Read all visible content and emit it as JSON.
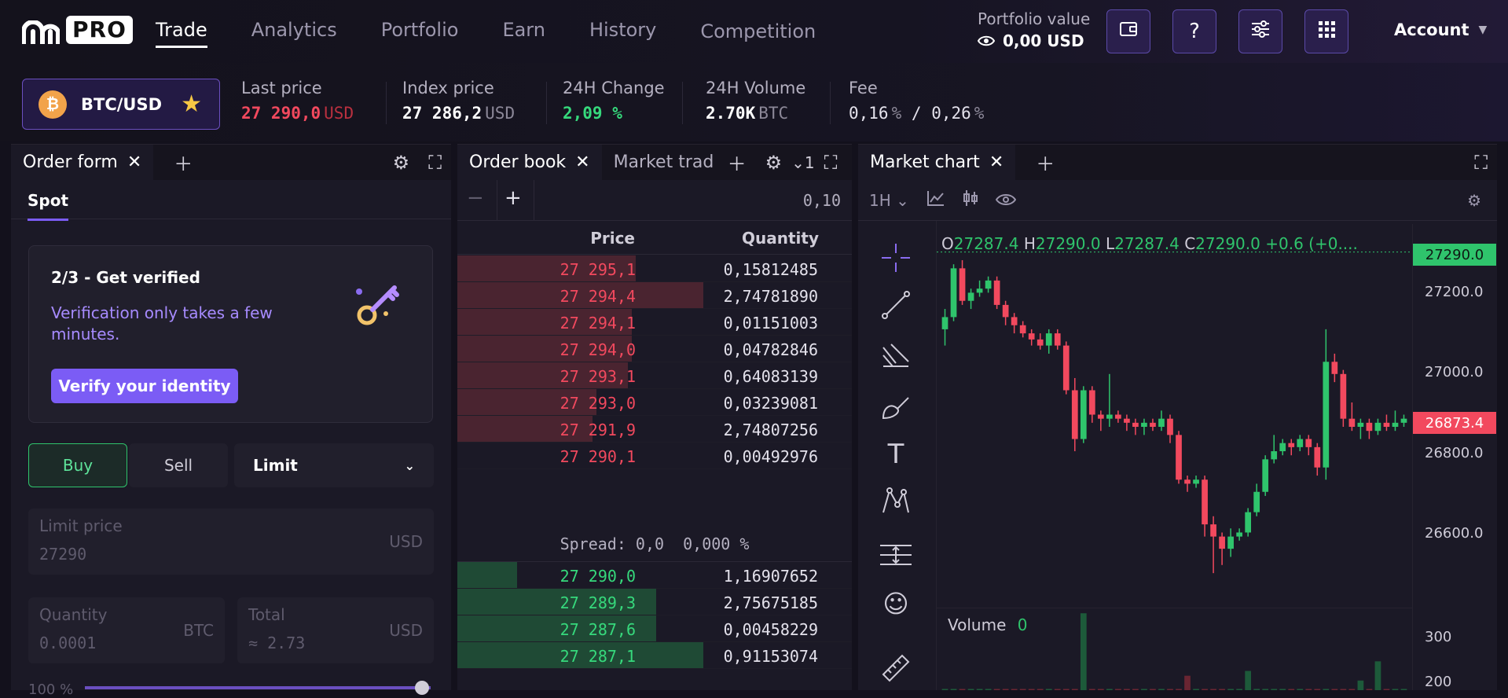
{
  "header": {
    "logo_text": "PRO",
    "nav": [
      "Trade",
      "Analytics",
      "Portfolio",
      "Earn",
      "History",
      "Competition"
    ],
    "portfolio_label": "Portfolio value",
    "portfolio_value": "0,00 USD",
    "account_label": "Account"
  },
  "ticker": {
    "pair": "BTC/USD",
    "last_price_label": "Last price",
    "last_price": "27 290,0",
    "last_price_unit": "USD",
    "index_price_label": "Index price",
    "index_price": "27 286,2",
    "index_price_unit": "USD",
    "change_label": "24H Change",
    "change": "2,09 %",
    "volume_label": "24H Volume",
    "volume": "2.70K",
    "volume_unit": "BTC",
    "fee_label": "Fee",
    "fee_maker": "0,16",
    "fee_taker": "0,26",
    "fee_pct": "%",
    "fee_sep": "/"
  },
  "order_form": {
    "tab_label": "Order form",
    "sub_tab": "Spot",
    "verify_title": "2/3 - Get verified",
    "verify_text": "Verification only takes a few minutes.",
    "verify_button": "Verify your identity",
    "buy_label": "Buy",
    "sell_label": "Sell",
    "order_type": "Limit",
    "limit_price_label": "Limit price",
    "limit_price_value": "27290",
    "limit_price_unit": "USD",
    "quantity_label": "Quantity",
    "quantity_value": "0.0001",
    "quantity_unit": "BTC",
    "total_label": "Total",
    "total_value": "≈ 2.73",
    "total_unit": "USD",
    "slider_label": "100 %"
  },
  "order_book": {
    "tab_label": "Order book",
    "tab2_label": "Market trad",
    "depth_count": "1",
    "tick_size": "0,10",
    "price_header": "Price",
    "qty_header": "Quantity",
    "spread": "Spread: 0,0  0,000 %",
    "asks": [
      {
        "price": "27 295,1",
        "qty": "0,15812485",
        "depth": 0.45
      },
      {
        "price": "27 294,4",
        "qty": "2,74781890",
        "depth": 0.62
      },
      {
        "price": "27 294,1",
        "qty": "0,01151003",
        "depth": 0.44
      },
      {
        "price": "27 294,0",
        "qty": "0,04782846",
        "depth": 0.44
      },
      {
        "price": "27 293,1",
        "qty": "0,64083139",
        "depth": 0.43
      },
      {
        "price": "27 293,0",
        "qty": "0,03239081",
        "depth": 0.35
      },
      {
        "price": "27 291,9",
        "qty": "2,74807256",
        "depth": 0.34
      },
      {
        "price": "27 290,1",
        "qty": "0,00492976",
        "depth": 0.0
      }
    ],
    "bids": [
      {
        "price": "27 290,0",
        "qty": "1,16907652",
        "depth": 0.15
      },
      {
        "price": "27 289,3",
        "qty": "2,75675185",
        "depth": 0.5
      },
      {
        "price": "27 287,6",
        "qty": "0,00458229",
        "depth": 0.5
      },
      {
        "price": "27 287,1",
        "qty": "0,91153074",
        "depth": 0.62
      }
    ]
  },
  "market_chart": {
    "tab_label": "Market chart",
    "interval": "1H",
    "ohlc": {
      "o": "O",
      "o_val": "27287.4",
      "h": "H",
      "h_val": "27290.0",
      "l": "L",
      "l_val": "27287.4",
      "c": "C",
      "c_val": "27290.0",
      "chg": "+0.6 (+0...."
    },
    "price_tag_top": "27290.0",
    "price_tag_mid": "26873.4",
    "y_ticks": [
      "27200.0",
      "27000.0",
      "26800.0",
      "26600.0"
    ],
    "volume_label": "Volume",
    "volume_value": "0",
    "vol_ticks": [
      "300",
      "200"
    ],
    "colors": {
      "up": "#2fc46c",
      "down": "#f2495e"
    }
  },
  "chart_data": {
    "type": "candlestick",
    "interval": "1H",
    "ylim": [
      26450,
      27330
    ],
    "candles": [
      [
        27100,
        27130,
        27060,
        27150,
        1
      ],
      [
        27130,
        27250,
        27120,
        27260,
        1
      ],
      [
        27250,
        27170,
        27160,
        27270,
        0
      ],
      [
        27170,
        27190,
        27150,
        27200,
        1
      ],
      [
        27190,
        27200,
        27180,
        27220,
        1
      ],
      [
        27200,
        27220,
        27190,
        27230,
        1
      ],
      [
        27220,
        27160,
        27150,
        27230,
        0
      ],
      [
        27160,
        27130,
        27110,
        27170,
        0
      ],
      [
        27130,
        27110,
        27090,
        27140,
        0
      ],
      [
        27110,
        27090,
        27080,
        27120,
        0
      ],
      [
        27090,
        27075,
        27060,
        27100,
        0
      ],
      [
        27075,
        27060,
        27050,
        27090,
        0
      ],
      [
        27060,
        27090,
        27040,
        27100,
        1
      ],
      [
        27090,
        27060,
        27050,
        27100,
        0
      ],
      [
        27060,
        26950,
        26940,
        27070,
        0
      ],
      [
        26950,
        26830,
        26800,
        26980,
        0
      ],
      [
        26830,
        26950,
        26820,
        26960,
        1
      ],
      [
        26950,
        26890,
        26870,
        26960,
        0
      ],
      [
        26890,
        26880,
        26850,
        26900,
        0
      ],
      [
        26880,
        26890,
        26860,
        26990,
        1
      ],
      [
        26890,
        26880,
        26870,
        26900,
        0
      ],
      [
        26880,
        26870,
        26850,
        26890,
        0
      ],
      [
        26870,
        26860,
        26840,
        26880,
        0
      ],
      [
        26860,
        26870,
        26840,
        26880,
        1
      ],
      [
        26870,
        26860,
        26850,
        26880,
        0
      ],
      [
        26860,
        26880,
        26850,
        26900,
        1
      ],
      [
        26880,
        26840,
        26820,
        26890,
        0
      ],
      [
        26840,
        26730,
        26720,
        26850,
        0
      ],
      [
        26730,
        26720,
        26700,
        26740,
        0
      ],
      [
        26720,
        26730,
        26710,
        26740,
        1
      ],
      [
        26730,
        26620,
        26590,
        26740,
        0
      ],
      [
        26620,
        26590,
        26500,
        26640,
        0
      ],
      [
        26590,
        26560,
        26520,
        26600,
        0
      ],
      [
        26560,
        26590,
        26540,
        26610,
        1
      ],
      [
        26590,
        26600,
        26580,
        26610,
        1
      ],
      [
        26600,
        26650,
        26590,
        26660,
        1
      ],
      [
        26650,
        26700,
        26640,
        26720,
        1
      ],
      [
        26700,
        26780,
        26690,
        26790,
        1
      ],
      [
        26780,
        26800,
        26770,
        26840,
        1
      ],
      [
        26800,
        26820,
        26790,
        26830,
        1
      ],
      [
        26820,
        26810,
        26790,
        26830,
        0
      ],
      [
        26810,
        26830,
        26800,
        26840,
        1
      ],
      [
        26830,
        26810,
        26790,
        26840,
        0
      ],
      [
        26810,
        26760,
        26740,
        26820,
        0
      ],
      [
        26760,
        27020,
        26730,
        27100,
        1
      ],
      [
        27020,
        26990,
        26970,
        27040,
        0
      ],
      [
        26990,
        26880,
        26860,
        27000,
        0
      ],
      [
        26880,
        26860,
        26850,
        26920,
        0
      ],
      [
        26860,
        26870,
        26830,
        26880,
        1
      ],
      [
        26870,
        26850,
        26830,
        26880,
        0
      ],
      [
        26850,
        26870,
        26840,
        26880,
        1
      ],
      [
        26870,
        26860,
        26850,
        26890,
        0
      ],
      [
        26860,
        26870,
        26850,
        26900,
        1
      ],
      [
        26870,
        26880,
        26860,
        26890,
        1
      ]
    ],
    "volumes": [
      5,
      5,
      5,
      5,
      5,
      5,
      5,
      5,
      5,
      5,
      5,
      5,
      5,
      5,
      5,
      5,
      320,
      5,
      5,
      5,
      5,
      5,
      5,
      5,
      5,
      5,
      5,
      5,
      60,
      5,
      5,
      5,
      5,
      5,
      5,
      80,
      5,
      5,
      5,
      5,
      5,
      5,
      5,
      5,
      5,
      5,
      5,
      5,
      40,
      5,
      120,
      5,
      5,
      5
    ]
  }
}
